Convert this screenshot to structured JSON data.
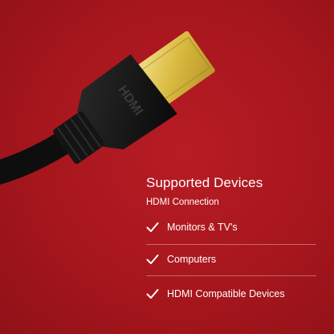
{
  "panel": {
    "title": "Supported Devices",
    "subtitle": "HDMI Connection"
  },
  "features": [
    {
      "label": "Monitors & TV's",
      "icon": "checkmark-icon"
    },
    {
      "label": "Computers",
      "icon": "checkmark-icon"
    },
    {
      "label": "HDMI Compatible Devices",
      "icon": "checkmark-icon"
    }
  ],
  "connector_text": "HDMI",
  "colors": {
    "background": "#a7161d",
    "text": "#ffffff",
    "cable": "#111111",
    "connector_tip": "#e6c84a"
  }
}
